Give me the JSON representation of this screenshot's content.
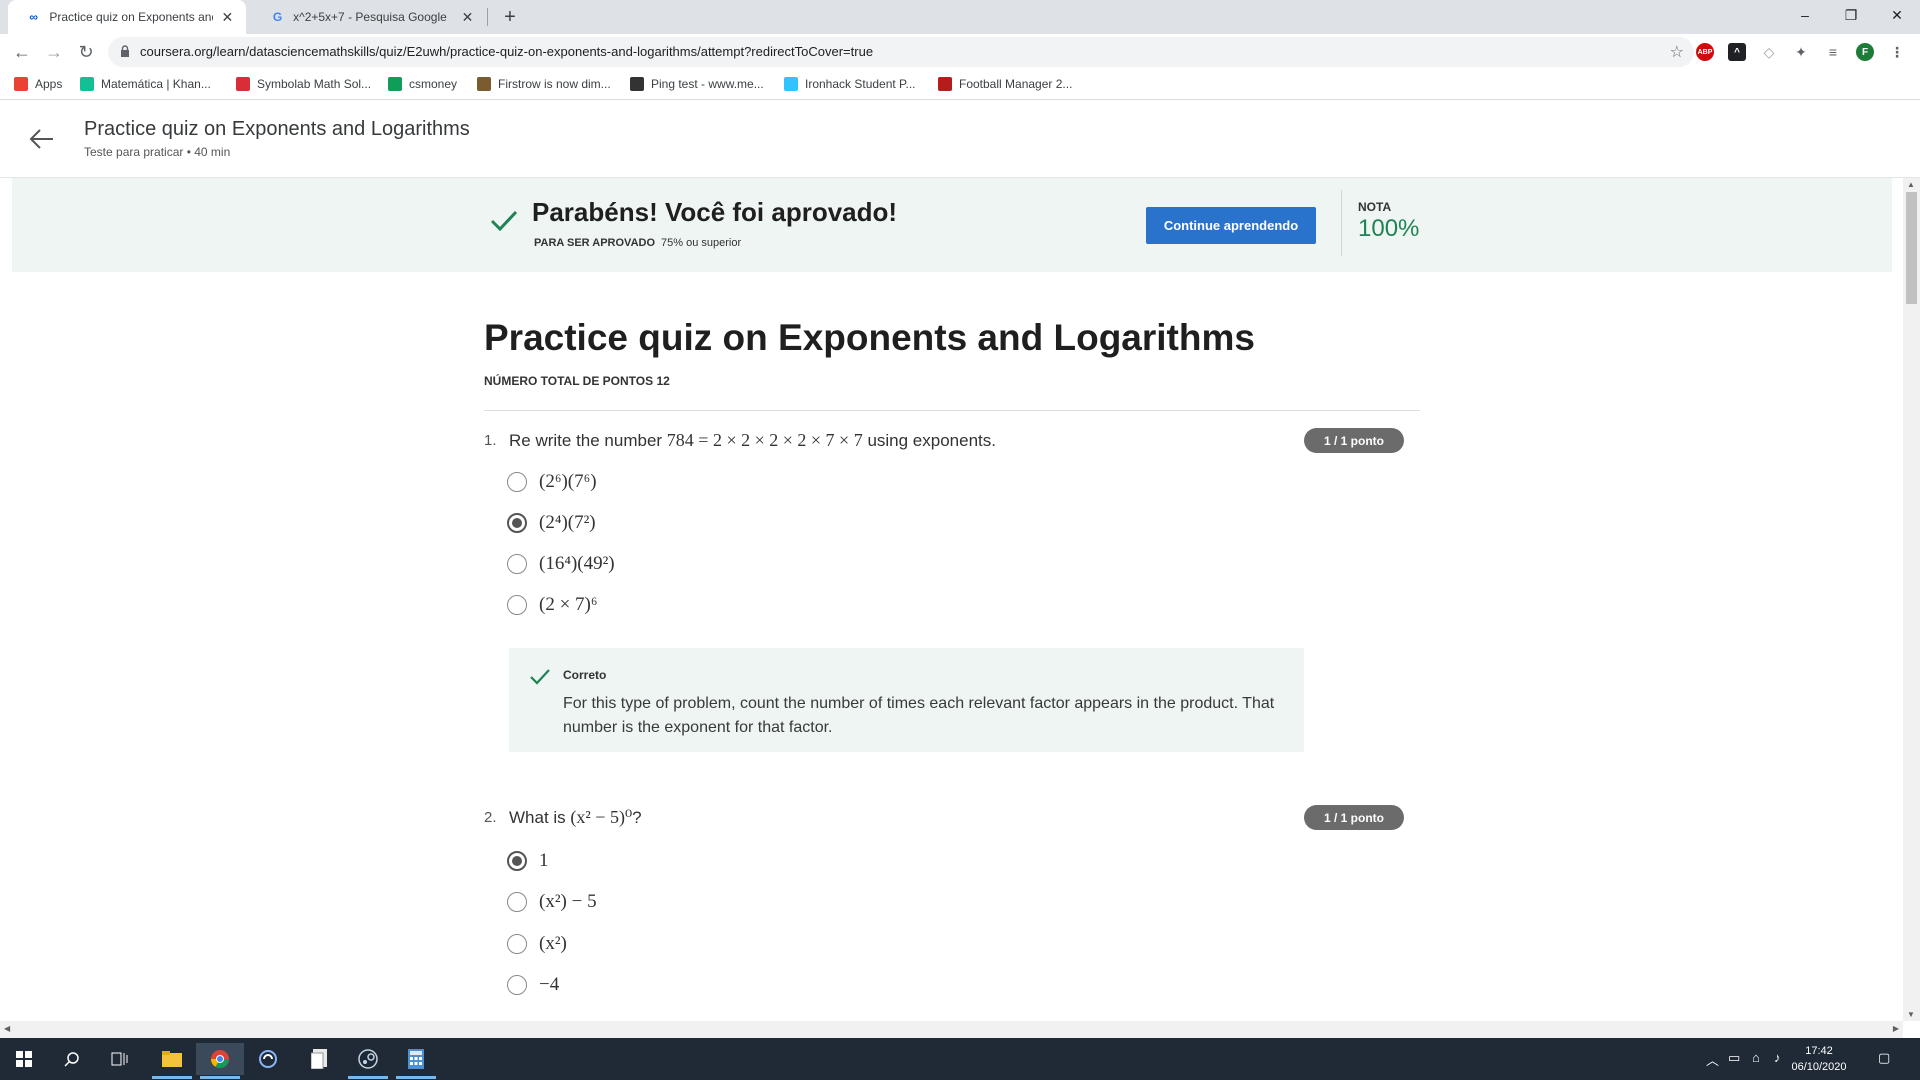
{
  "browser": {
    "tabs": [
      {
        "title": "Practice quiz on Exponents and L",
        "active": true
      },
      {
        "title": "x^2+5x+7 - Pesquisa Google",
        "active": false
      }
    ],
    "new_tab_symbol": "+",
    "window_controls": {
      "minimize": "–",
      "restore": "❐",
      "close": "✕"
    },
    "url": "coursera.org/learn/datasciencemathskills/quiz/E2uwh/practice-quiz-on-exponents-and-logarithms/attempt?redirectToCover=true",
    "extensions": [
      {
        "name": "adblock-icon",
        "label": "ABP",
        "color": "#d10b0b"
      },
      {
        "name": "extension-dark-icon",
        "label": "^",
        "color": "#202124"
      },
      {
        "name": "shield-extension-icon",
        "label": "◇",
        "color": "#9aa0a6"
      },
      {
        "name": "puzzle-icon",
        "label": "✦",
        "color": "#5f6368"
      },
      {
        "name": "media-queue-icon",
        "label": "≡",
        "color": "#5f6368"
      },
      {
        "name": "profile-avatar",
        "label": "F",
        "color": "#1e7c3a"
      },
      {
        "name": "menu-kebab-icon",
        "label": "⋮",
        "color": "#5f6368"
      }
    ],
    "bookmarks": [
      {
        "label": "Apps",
        "icon": "apps-grid-icon",
        "color": "#ea4335"
      },
      {
        "label": "Matemática | Khan...",
        "icon": "khan-academy-icon",
        "color": "#14bf96"
      },
      {
        "label": "Symbolab Math Sol...",
        "icon": "symbolab-icon",
        "color": "#d92d3a"
      },
      {
        "label": "csmoney",
        "icon": "csmoney-icon",
        "color": "#0f9d58"
      },
      {
        "label": "Firstrow is now dim...",
        "icon": "firstrow-icon",
        "color": "#7a5c2e"
      },
      {
        "label": "Ping test - www.me...",
        "icon": "ping-test-icon",
        "color": "#333333"
      },
      {
        "label": "Ironhack Student P...",
        "icon": "ironhack-icon",
        "color": "#32c3ff"
      },
      {
        "label": "Football Manager 2...",
        "icon": "football-manager-icon",
        "color": "#b71c1c"
      }
    ]
  },
  "header": {
    "title": "Practice quiz on Exponents and Logarithms",
    "subtitle": "Teste para praticar • 40 min"
  },
  "banner": {
    "title": "Parabéns! Você foi aprovado!",
    "requirement_label": "PARA SER APROVADO",
    "requirement_value": "75% ou superior",
    "continue_label": "Continue aprendendo",
    "grade_label": "NOTA",
    "grade_value": "100%",
    "accent_color": "#1f8354"
  },
  "quiz": {
    "title": "Practice quiz on Exponents and Logarithms",
    "total_points": "NÚMERO TOTAL DE PONTOS 12",
    "questions": [
      {
        "number": "1.",
        "text_before": "Re write the number ",
        "math": "784 = 2 × 2 × 2 × 2 × 7 × 7",
        "text_after": " using exponents.",
        "score": "1 / 1 ponto",
        "selected": 1,
        "options": [
          "(2⁶)(7⁶)",
          "(2⁴)(7²)",
          "(16⁴)(49²)",
          "(2 × 7)⁶"
        ],
        "feedback": {
          "title": "Correto",
          "text": "For this type of problem, count the number of times each relevant factor appears in the product. That number is the exponent for that factor."
        }
      },
      {
        "number": "2.",
        "text_before": "What is ",
        "math": "(x² − 5)⁰",
        "text_after": "?",
        "score": "1 / 1 ponto",
        "selected": 0,
        "options": [
          "1",
          "(x²) − 5",
          "(x²)",
          "−4"
        ]
      }
    ]
  },
  "taskbar": {
    "time": "17:42",
    "date": "06/10/2020"
  }
}
